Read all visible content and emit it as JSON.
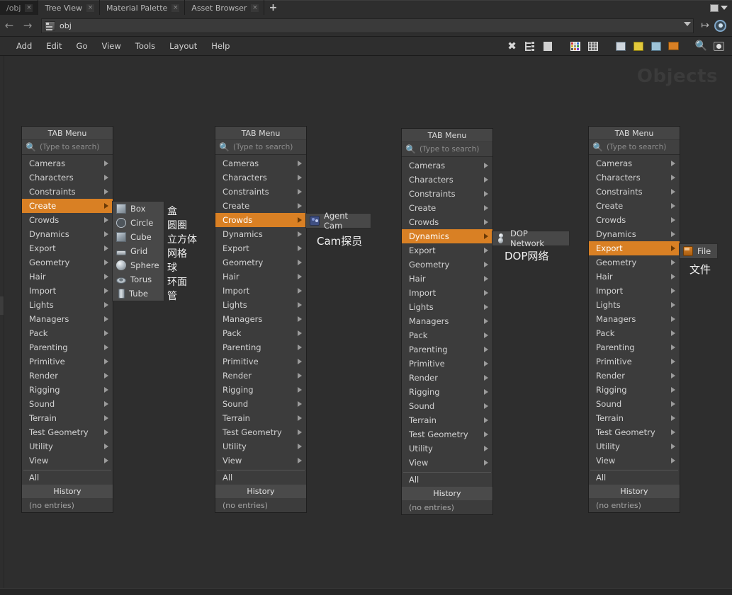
{
  "window": {
    "tabs": [
      {
        "label": "/obj",
        "active": true,
        "close": "×"
      },
      {
        "label": "Tree View",
        "active": false,
        "close": "×"
      },
      {
        "label": "Material Palette",
        "active": false,
        "close": "×"
      },
      {
        "label": "Asset Browser",
        "active": false,
        "close": "×"
      }
    ],
    "new_tab_label": "+",
    "maximize_icon": "window-icon",
    "dropdown_icon": "chevron-down-icon"
  },
  "pathbar": {
    "back_icon": "←",
    "forward_icon": "→",
    "node_icon": "network-icon",
    "value": "obj",
    "dropdown_icon": "chevron-down-icon",
    "pin_icon": "↦",
    "view_icon": "viewport-icon"
  },
  "menubar": {
    "items": [
      "Add",
      "Edit",
      "Go",
      "View",
      "Tools",
      "Layout",
      "Help"
    ],
    "toolbar_icons": [
      "wrench-icon",
      "tree-icon",
      "list-icon",
      "color-palette-icon",
      "grid-icon",
      "network-box-icon",
      "notes-icon",
      "image-icon",
      "drawer-icon",
      "search-icon",
      "eye-icon"
    ]
  },
  "viewport": {
    "watermark": "Objects"
  },
  "colors": {
    "highlight": "#d98024",
    "panel_bg": "#3c3c3c",
    "submenu_bg": "#484848",
    "app_bg": "#2e2e2e"
  },
  "tab_menu": {
    "title": "TAB Menu",
    "search_placeholder": "(Type to search)",
    "search_icon": "search-icon",
    "categories": [
      "Cameras",
      "Characters",
      "Constraints",
      "Create",
      "Crowds",
      "Dynamics",
      "Export",
      "Geometry",
      "Hair",
      "Import",
      "Lights",
      "Managers",
      "Pack",
      "Parenting",
      "Primitive",
      "Render",
      "Rigging",
      "Sound",
      "Terrain",
      "Test Geometry",
      "Utility",
      "View"
    ],
    "all_label": "All",
    "history_label": "History",
    "no_entries_label": "(no entries)"
  },
  "panels": [
    {
      "id": "panel-create",
      "selected": "Create",
      "submenu": {
        "items": [
          {
            "label": "Box",
            "icon": "box-icon",
            "cn": "盒"
          },
          {
            "label": "Circle",
            "icon": "circle-icon",
            "cn": "圆圈"
          },
          {
            "label": "Cube",
            "icon": "cube-icon",
            "cn": "立方体"
          },
          {
            "label": "Grid",
            "icon": "grid-icon",
            "cn": "网格"
          },
          {
            "label": "Sphere",
            "icon": "sphere-icon",
            "cn": "球"
          },
          {
            "label": "Torus",
            "icon": "torus-icon",
            "cn": "环面"
          },
          {
            "label": "Tube",
            "icon": "tube-icon",
            "cn": "管"
          }
        ]
      }
    },
    {
      "id": "panel-crowds",
      "selected": "Crowds",
      "submenu": {
        "items": [
          {
            "label": "Agent Cam",
            "icon": "agent-icon",
            "cn": "Cam探员"
          }
        ]
      }
    },
    {
      "id": "panel-dynamics",
      "selected": "Dynamics",
      "submenu": {
        "items": [
          {
            "label": "DOP Network",
            "icon": "dop-icon",
            "cn": "DOP网络"
          }
        ]
      }
    },
    {
      "id": "panel-export",
      "selected": "Export",
      "submenu": {
        "items": [
          {
            "label": "File",
            "icon": "file-icon",
            "cn": "文件"
          }
        ]
      }
    }
  ]
}
